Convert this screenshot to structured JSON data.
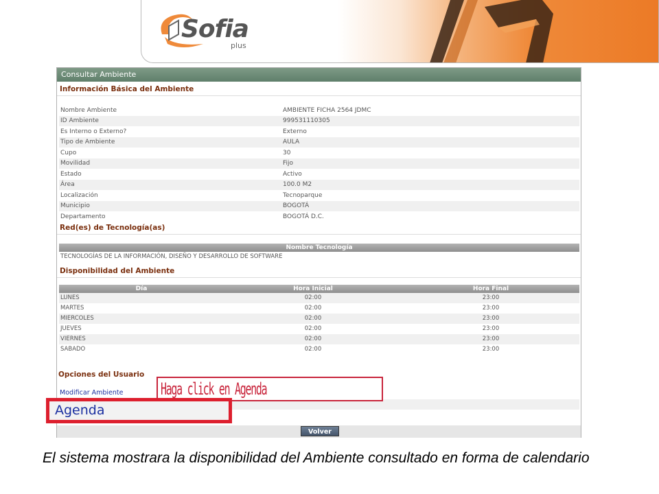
{
  "logo": {
    "brand": "Sofia",
    "suffix": "plus"
  },
  "panel": {
    "title": "Consultar Ambiente",
    "basic_info": {
      "title": "Información Básica del Ambiente",
      "rows": [
        {
          "label": "Nombre Ambiente",
          "value": "AMBIENTE FICHA 2564 JDMC"
        },
        {
          "label": "ID Ambiente",
          "value": "999531110305"
        },
        {
          "label": "Es Interno o Externo?",
          "value": "Externo"
        },
        {
          "label": "Tipo de Ambiente",
          "value": "AULA"
        },
        {
          "label": "Cupo",
          "value": "30"
        },
        {
          "label": "Movilidad",
          "value": "Fijo"
        },
        {
          "label": "Estado",
          "value": "Activo"
        },
        {
          "label": "Área",
          "value": "100.0 M2"
        },
        {
          "label": "Localización",
          "value": "Tecnoparque"
        },
        {
          "label": "Municipio",
          "value": "BOGOTÁ"
        },
        {
          "label": "Departamento",
          "value": "BOGOTÁ D.C."
        }
      ]
    },
    "tech": {
      "title": "Red(es) de Tecnología(as)",
      "header": "Nombre Tecnología",
      "rows": [
        "TECNOLOGÍAS DE LA INFORMACIÓN, DISEÑO Y DESARROLLO DE SOFTWARE"
      ]
    },
    "availability": {
      "title": "Disponibilidad del Ambiente",
      "headers": [
        "Día",
        "Hora Inicial",
        "Hora Final"
      ],
      "rows": [
        [
          "LUNES",
          "02:00",
          "23:00"
        ],
        [
          "MARTES",
          "02:00",
          "23:00"
        ],
        [
          "MIERCOLES",
          "02:00",
          "23:00"
        ],
        [
          "JUEVES",
          "02:00",
          "23:00"
        ],
        [
          "VIERNES",
          "02:00",
          "23:00"
        ],
        [
          "SABADO",
          "02:00",
          "23:00"
        ]
      ]
    },
    "options": {
      "title": "Opciones del Usuario",
      "modify_label": "Modificar Ambiente",
      "agenda_label": "Agenda"
    },
    "volver_label": "Volver"
  },
  "hint": "Haga click en Agenda",
  "caption": "El sistema mostrara la disponibilidad del Ambiente consultado en forma de calendario",
  "colors": {
    "accent": "#ec7a26",
    "section_title": "#7a2f0e",
    "link": "#1a2fa0",
    "callout": "#dd1f2e",
    "panel_header": "#6c8a76"
  }
}
